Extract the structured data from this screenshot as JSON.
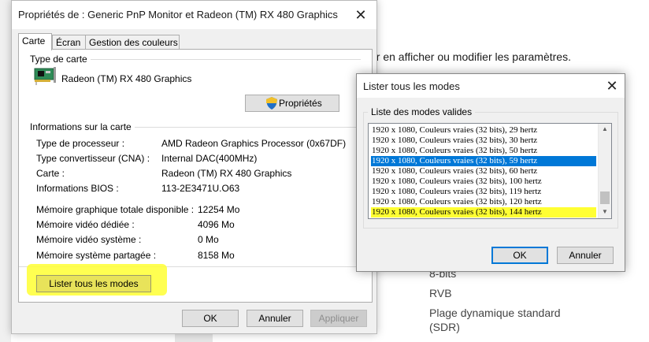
{
  "background_page": {
    "line1": "ur en afficher ou modifier les paramètres.",
    "line2": "8-bits",
    "line3": "RVB",
    "line4a": "Plage dynamique standard",
    "line4b": "(SDR)"
  },
  "properties_window": {
    "title": "Propriétés de : Generic PnP Monitor et Radeon (TM) RX 480 Graphics",
    "close_glyph": "✕",
    "tabs": [
      {
        "label": "Carte"
      },
      {
        "label": "Écran"
      },
      {
        "label": "Gestion des couleurs"
      }
    ],
    "adapter_type": {
      "group_label": "Type de carte",
      "name": "Radeon (TM) RX 480 Graphics",
      "properties_button": "Propriétés"
    },
    "adapter_info": {
      "group_label": "Informations sur la carte",
      "rows": [
        {
          "label": "Type de processeur :",
          "value": "AMD Radeon Graphics Processor (0x67DF)"
        },
        {
          "label": "Type convertisseur (CNA) :",
          "value": "Internal DAC(400MHz)"
        },
        {
          "label": "Carte :",
          "value": "Radeon (TM) RX 480 Graphics"
        },
        {
          "label": "Informations BIOS :",
          "value": "113-2E3471U.O63"
        }
      ],
      "memory_rows": [
        {
          "label": "Mémoire graphique totale disponible :",
          "value": "12254 Mo"
        },
        {
          "label": "Mémoire vidéo dédiée :",
          "value": "4096 Mo"
        },
        {
          "label": "Mémoire vidéo système :",
          "value": "0 Mo"
        },
        {
          "label": "Mémoire système partagée :",
          "value": "8158 Mo"
        }
      ]
    },
    "list_modes_button": "Lister tous les modes",
    "footer": {
      "ok": "OK",
      "cancel": "Annuler",
      "apply": "Appliquer"
    },
    "highlight_color": "#ffff33"
  },
  "modes_dialog": {
    "title": "Lister tous les modes",
    "close_glyph": "✕",
    "group_label": "Liste des modes valides",
    "modes": [
      {
        "label": "1920 x 1080, Couleurs vraies (32 bits), 29 hertz"
      },
      {
        "label": "1920 x 1080, Couleurs vraies (32 bits), 30 hertz"
      },
      {
        "label": "1920 x 1080, Couleurs vraies (32 bits), 50 hertz"
      },
      {
        "label": "1920 x 1080, Couleurs vraies (32 bits), 59 hertz"
      },
      {
        "label": "1920 x 1080, Couleurs vraies (32 bits), 60 hertz"
      },
      {
        "label": "1920 x 1080, Couleurs vraies (32 bits), 100 hertz"
      },
      {
        "label": "1920 x 1080, Couleurs vraies (32 bits), 119 hertz"
      },
      {
        "label": "1920 x 1080, Couleurs vraies (32 bits), 120 hertz"
      },
      {
        "label": "1920 x 1080, Couleurs vraies (32 bits), 144 hertz"
      }
    ],
    "selected_index": 3,
    "highlighted_index": 8,
    "ok": "OK",
    "cancel": "Annuler",
    "selection_color": "#0078d7"
  }
}
